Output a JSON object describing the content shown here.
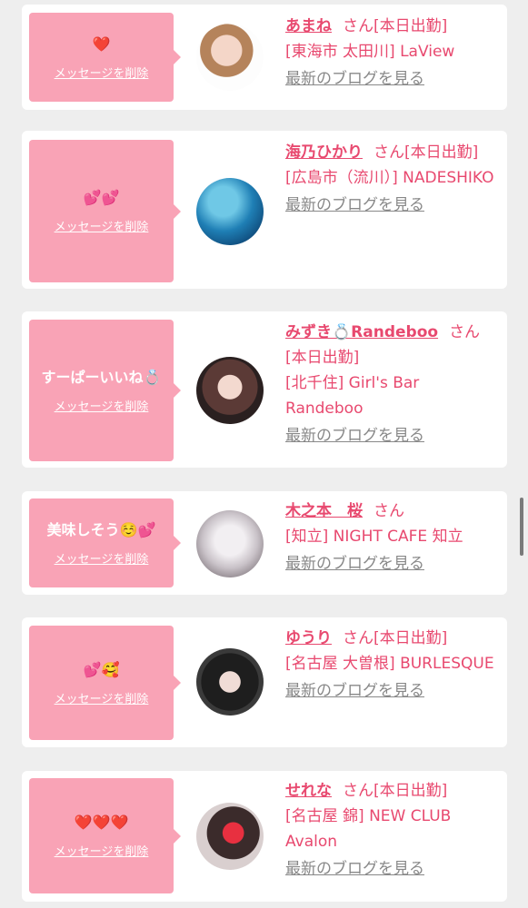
{
  "delete_label": "メッセージを削除",
  "blog_label": "最新のブログを見る",
  "cards": [
    {
      "message": "❤️",
      "name": "あまね",
      "suffix": "さん[本日出勤]",
      "location": "[東海市 太田川] LaView"
    },
    {
      "message": "💕💕",
      "name": "海乃ひかり",
      "suffix": "さん[本日出勤]",
      "location": "[広島市（流川）] NADESHIKO"
    },
    {
      "message": "すーぱーいいね💍",
      "name": "みずき💍Randeboo",
      "suffix": "さん[本日出勤]",
      "location": "[北千住] Girl's Bar Randeboo"
    },
    {
      "message": "美味しそう☺️💕",
      "name": "木之本　桜",
      "suffix": "さん",
      "location": "[知立] NIGHT CAFE 知立"
    },
    {
      "message": "💕🥰",
      "name": "ゆうり",
      "suffix": "さん[本日出勤]",
      "location": "[名古屋 大曽根] BURLESQUE"
    },
    {
      "message": "❤️❤️❤️",
      "name": "せれな",
      "suffix": "さん[本日出勤]",
      "location": "[名古屋 錦] NEW CLUB Avalon"
    }
  ],
  "colors": {
    "accent": "#e8496f",
    "bubble": "#f9a3b6",
    "background": "#eeeeee"
  }
}
